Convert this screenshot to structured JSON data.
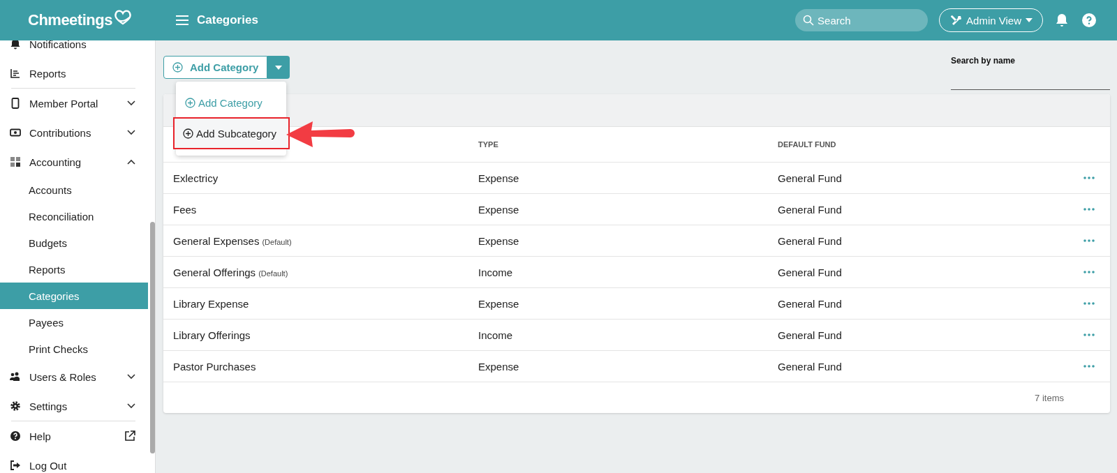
{
  "header": {
    "logo": "Chmeetings",
    "title": "Categories",
    "search": {
      "placeholder": "Search"
    },
    "view_button": "Admin View"
  },
  "sidebar": {
    "items": [
      {
        "label": "Notifications",
        "kind": "bell"
      },
      {
        "label": "Reports",
        "kind": "chart",
        "divider_after": true
      },
      {
        "label": "Member Portal",
        "kind": "phone",
        "expanded": false
      },
      {
        "label": "Contributions",
        "kind": "cash",
        "expanded": false
      },
      {
        "label": "Accounting",
        "kind": "grid",
        "expanded": true,
        "children": [
          {
            "label": "Accounts",
            "selected": false
          },
          {
            "label": "Reconciliation",
            "selected": false
          },
          {
            "label": "Budgets",
            "selected": false
          },
          {
            "label": "Reports",
            "selected": false
          },
          {
            "label": "Categories",
            "selected": true
          },
          {
            "label": "Payees",
            "selected": false
          },
          {
            "label": "Print Checks",
            "selected": false
          }
        ]
      },
      {
        "label": "Users & Roles",
        "kind": "users",
        "expanded": false
      },
      {
        "label": "Settings",
        "kind": "gear",
        "expanded": false,
        "divider_after": true
      },
      {
        "label": "Help",
        "kind": "help",
        "external": true
      },
      {
        "label": "Log Out",
        "kind": "logout"
      }
    ]
  },
  "toolbar": {
    "add_button": "Add Category",
    "menu": [
      {
        "label": "Add Category",
        "selected": false
      },
      {
        "label": "Add Subcategory",
        "selected": true
      }
    ],
    "search_label": "Search by name"
  },
  "table": {
    "columns": [
      "",
      "TYPE",
      "DEFAULT FUND"
    ],
    "rows": [
      {
        "name": "Exlectricy",
        "type": "Expense",
        "fund": "General Fund"
      },
      {
        "name": "Fees",
        "type": "Expense",
        "fund": "General Fund"
      },
      {
        "name": "General Expenses",
        "tag": "(Default)",
        "type": "Expense",
        "fund": "General Fund"
      },
      {
        "name": "General Offerings",
        "tag": "(Default)",
        "type": "Income",
        "fund": "General Fund"
      },
      {
        "name": "Library Expense",
        "type": "Expense",
        "fund": "General Fund"
      },
      {
        "name": "Library Offerings",
        "type": "Income",
        "fund": "General Fund"
      },
      {
        "name": "Pastor Purchases",
        "type": "Expense",
        "fund": "General Fund"
      }
    ],
    "footer": "7 items"
  }
}
